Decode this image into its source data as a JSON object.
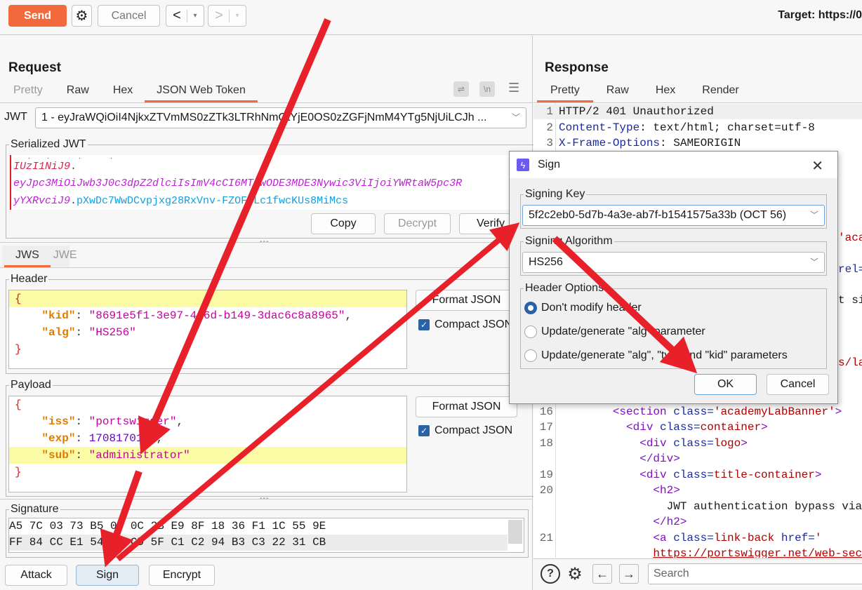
{
  "toolbar": {
    "send_label": "Send",
    "cancel_label": "Cancel",
    "back_glyph": "<",
    "forward_glyph": ">",
    "dropdown_glyph": "▾",
    "target_label": "Target: https://0"
  },
  "request": {
    "title": "Request",
    "tabs": [
      {
        "label": "Pretty",
        "active": false
      },
      {
        "label": "Raw",
        "active": false
      },
      {
        "label": "Hex",
        "active": false
      },
      {
        "label": "JSON Web Token",
        "active": true
      }
    ],
    "tool_icons": [
      "wrap-lines-icon",
      "newline-icon",
      "menu-icon"
    ],
    "newline_glyph": "\\n",
    "jwt_label": "JWT",
    "jwt_selected": "1 - eyJraWQiOiI4NjkxZTVmMS0zZTk3LTRhNmQtYjE0OS0zZGFjNmM4YTg5NjUiLCJh ...",
    "serialized": {
      "legend": "Serialized JWT",
      "line1_header": "IUzI1NiJ9",
      "line2_payload": "eyJpc3MiOiJwb3J0c3dpZ2dlciIsImV4cCI6MTcwODE3MDE3Nywic3ViIjoiYWRtaW5pc3R",
      "line3_payload_end": "yYXRvciJ9",
      "line3_signature": "pXwDc7WwDCvpjxg28RxVnv-FZOFULc1fwcKUs8MiMcs",
      "buttons": {
        "copy": "Copy",
        "decrypt": "Decrypt",
        "verify": "Verify"
      }
    },
    "mode_tabs": [
      {
        "label": "JWS",
        "active": true
      },
      {
        "label": "JWE",
        "active": false
      }
    ],
    "header": {
      "legend": "Header",
      "kid_key": "kid",
      "kid_value": "8691e5f1-3e97-4a6d-b149-3dac6c8a8965",
      "alg_key": "alg",
      "alg_value": "HS256",
      "format_button": "Format JSON",
      "compact_label": "Compact JSON",
      "compact_checked": true
    },
    "payload": {
      "legend": "Payload",
      "iss_key": "iss",
      "iss_value": "portswigger",
      "exp_key": "exp",
      "exp_value": "1708170177",
      "sub_key": "sub",
      "sub_value": "administrator",
      "format_button": "Format JSON",
      "compact_label": "Compact JSON",
      "compact_checked": true
    },
    "signature": {
      "legend": "Signature",
      "line1": "A5 7C 03 73 B5 0D 0C 2B E9 8F 18 36 F1 1C 55 9E",
      "line2": "FF 84 CC E1 54 DD CD 5F C1 C2 94 B3 C3 22 31 CB"
    },
    "actions": {
      "attack": "Attack",
      "sign": "Sign",
      "encrypt": "Encrypt"
    }
  },
  "response": {
    "title": "Response",
    "tabs": [
      {
        "label": "Pretty",
        "active": true
      },
      {
        "label": "Raw",
        "active": false
      },
      {
        "label": "Hex",
        "active": false
      },
      {
        "label": "Render",
        "active": false
      }
    ],
    "lines_top": [
      {
        "num": "1",
        "text": "HTTP/2 401 Unauthorized"
      },
      {
        "num": "2",
        "name": "Content-Type",
        "value": ": text/html; charset=utf-8"
      },
      {
        "num": "3",
        "name": "X-Frame-Options",
        "value": ": SAMEORIGIN"
      }
    ],
    "peek": {
      "l1": "'acad",
      "l2": "rel=",
      "l3": "t si",
      "l4": "s/la"
    },
    "lines_bottom": {
      "l16_num": "16",
      "l16_tag": "<section",
      "l16_attr": " class=",
      "l16_val": "'academyLabBanner'",
      "l16_end": ">",
      "l17_num": "17",
      "l17_tag": "<div",
      "l17_attr": " class=",
      "l17_val": "container",
      "l17_end": ">",
      "l18_num": "18",
      "l18_tag": "<div",
      "l18_attr": " class=",
      "l18_val": "logo",
      "l18_end": ">",
      "l18b": "</div>",
      "l19_num": "19",
      "l19_tag": "<div",
      "l19_attr": " class=",
      "l19_val": "title-container",
      "l19_end": ">",
      "l20_num": "20",
      "l20_tag": "<h2>",
      "l20b": "JWT authentication bypass via",
      "l20c": "</h2>",
      "l21_num": "21",
      "l21_tag": "<a",
      "l21_attr": " class=",
      "l21_val": "link-back",
      "l21_attr2": " href=",
      "l21_q": "'",
      "l21b": "https://portswigger.net/web-secu"
    },
    "search_placeholder": "Search"
  },
  "dialog": {
    "title": "Sign",
    "signing_key_legend": "Signing Key",
    "signing_key_value": "5f2c2eb0-5d7b-4a3e-ab7f-b1541575a33b (OCT 56)",
    "signing_alg_legend": "Signing Algorithm",
    "signing_alg_value": "HS256",
    "header_options_legend": "Header Options",
    "options": [
      {
        "label": "Don't modify header",
        "selected": true
      },
      {
        "label": "Update/generate \"alg\" parameter",
        "selected": false
      },
      {
        "label": "Update/generate \"alg\", \"typ\" and \"kid\" parameters",
        "selected": false
      }
    ],
    "ok_label": "OK",
    "cancel_label": "Cancel"
  },
  "annotation": {
    "arrow_color": "#e8202a"
  }
}
